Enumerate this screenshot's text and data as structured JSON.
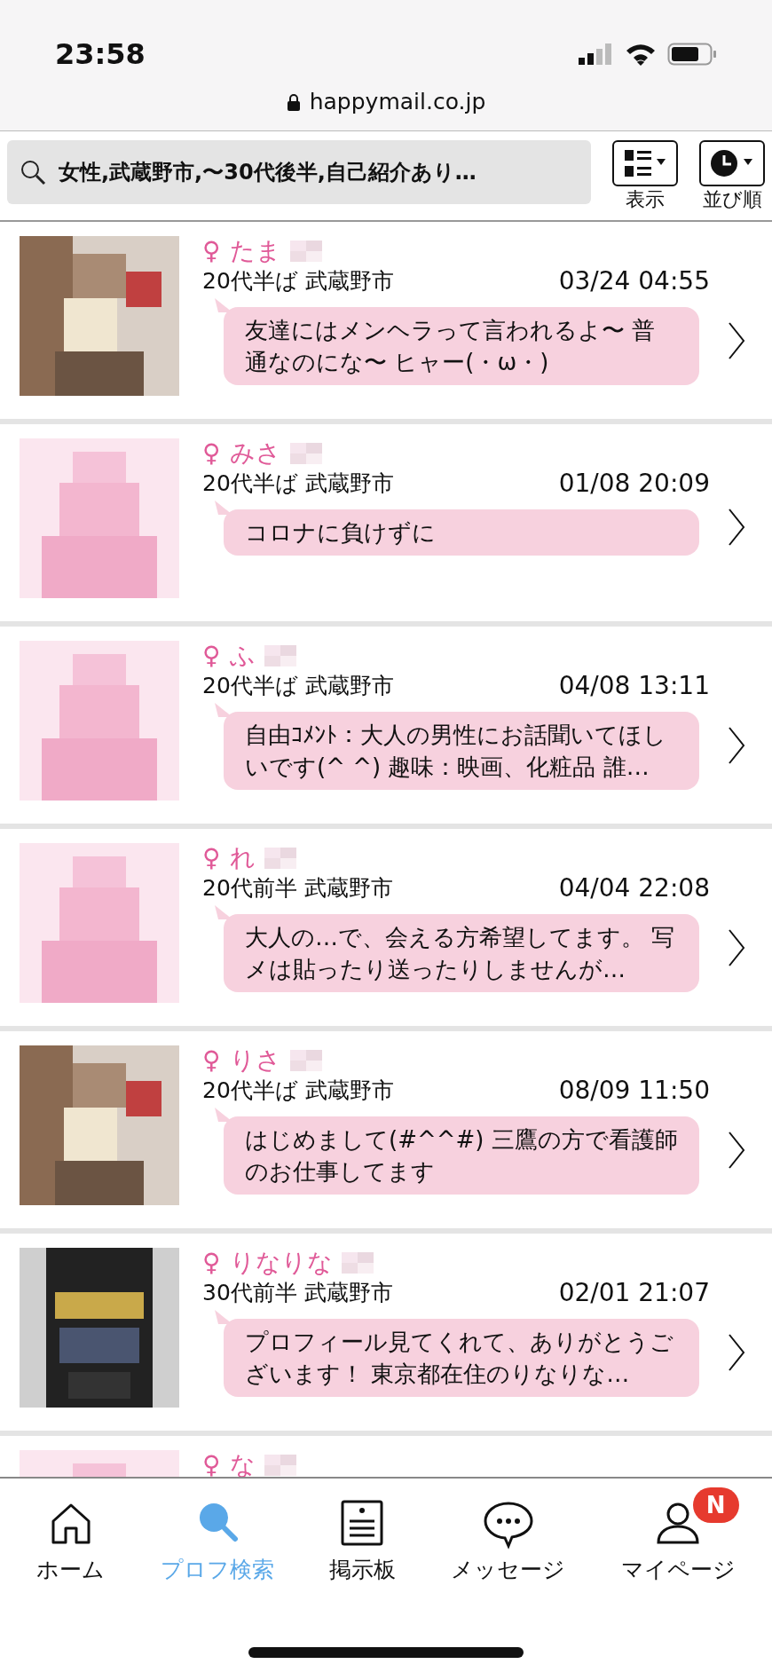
{
  "status_bar": {
    "time": "23:58"
  },
  "browser": {
    "url": "happymail.co.jp"
  },
  "search": {
    "value": "女性,武蔵野市,〜30代後半,自己紹介あり…"
  },
  "toolbar": [
    {
      "kind": "view",
      "label": "表示"
    },
    {
      "kind": "sort",
      "label": "並び順"
    }
  ],
  "profiles": [
    {
      "gender": "♀",
      "name": "たま",
      "age_area": "20代半ば 武蔵野市",
      "time": "03/24 04:55",
      "message": "友達にはメンヘラって言われるよ〜 普通なのにな〜 ヒャー(・ω・)"
    },
    {
      "kind": "placeholder",
      "gender": "♀",
      "name": "みさ",
      "age_area": "20代半ば 武蔵野市",
      "time": "01/08 20:09",
      "message": "コロナに負けずに"
    },
    {
      "kind": "placeholder",
      "gender": "♀",
      "name": "ふ",
      "age_area": "20代半ば 武蔵野市",
      "time": "04/08 13:11",
      "message": "自由ｺﾒﾝﾄ：大人の男性にお話聞いてほしいです(^ ^) 趣味：映画、化粧品 誰…"
    },
    {
      "kind": "placeholder",
      "gender": "♀",
      "name": "れ",
      "age_area": "20代前半 武蔵野市",
      "time": "04/04 22:08",
      "message": "大人の…で、会える方希望してます。 写メは貼ったり送ったりしませんが…"
    },
    {
      "gender": "♀",
      "name": "りさ",
      "age_area": "20代半ば 武蔵野市",
      "time": "08/09 11:50",
      "message": "はじめまして(#^^#) 三鷹の方で看護師のお仕事してます"
    },
    {
      "kind": "dark",
      "gender": "♀",
      "name": "りなりな",
      "age_area": "30代前半 武蔵野市",
      "time": "02/01 21:07",
      "message": "プロフィール見てくれて、ありがとうございます！ 東京都在住のりなりな…"
    },
    {
      "kind": "placeholder",
      "gender": "♀",
      "name": "な"
    }
  ],
  "nav": [
    {
      "kind": "home",
      "label": "ホーム",
      "selected": false
    },
    {
      "kind": "search",
      "label": "プロフ検索",
      "selected": true
    },
    {
      "kind": "board",
      "label": "掲示板",
      "selected": false
    },
    {
      "kind": "message",
      "label": "メッセージ",
      "selected": false
    },
    {
      "kind": "mypage",
      "label": "マイページ",
      "selected": false,
      "badge": "N"
    }
  ]
}
